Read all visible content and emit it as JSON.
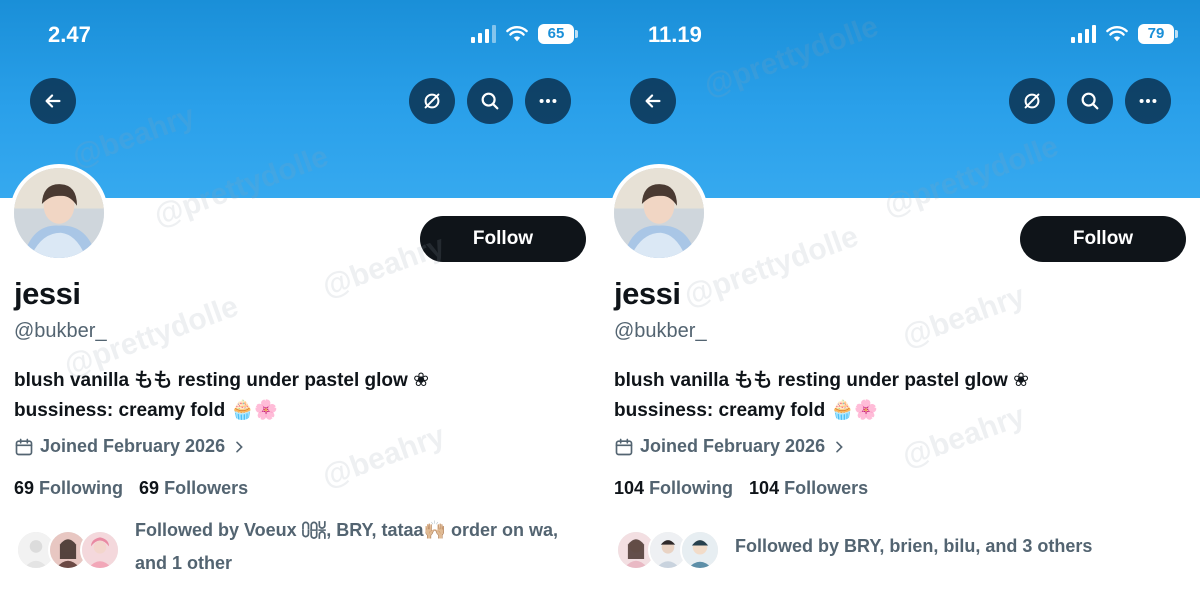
{
  "screens": [
    {
      "status_time": "2.47",
      "battery": "65",
      "profile": {
        "name": "jessi",
        "handle": "@bukber_",
        "bio_line1": "blush vanilla もも resting under pastel glow ❀",
        "bio_line2": "bussiness: creamy fold 🧁🌸",
        "joined": "Joined February 2026",
        "following_count": "69",
        "following_label": "Following",
        "followers_count": "69",
        "followers_label": "Followers",
        "followed_by": "Followed by  Voeux ⩇⩉⩈, BRY, tataa🙌🏼 order on wa, and 1 other",
        "follow_label": "Follow"
      }
    },
    {
      "status_time": "11.19",
      "battery": "79",
      "profile": {
        "name": "jessi",
        "handle": "@bukber_",
        "bio_line1": "blush vanilla もも resting under pastel glow ❀",
        "bio_line2": "bussiness: creamy fold 🧁🌸",
        "joined": "Joined February 2026",
        "following_count": "104",
        "following_label": "Following",
        "followers_count": "104",
        "followers_label": "Followers",
        "followed_by": "Followed by BRY, brien, bilu, and 3 others",
        "follow_label": "Follow"
      }
    }
  ],
  "watermarks": [
    "@beahry",
    "@prettydolle"
  ],
  "icons": {
    "back": "arrow-left-icon",
    "notify": "bell-slash-icon",
    "search": "search-icon",
    "more": "more-icon",
    "calendar": "calendar-icon",
    "chevron": "chevron-right-icon"
  },
  "colors": {
    "banner": "#1d9bf0",
    "follow_button": "#0f1419",
    "secondary_text": "#536471"
  }
}
